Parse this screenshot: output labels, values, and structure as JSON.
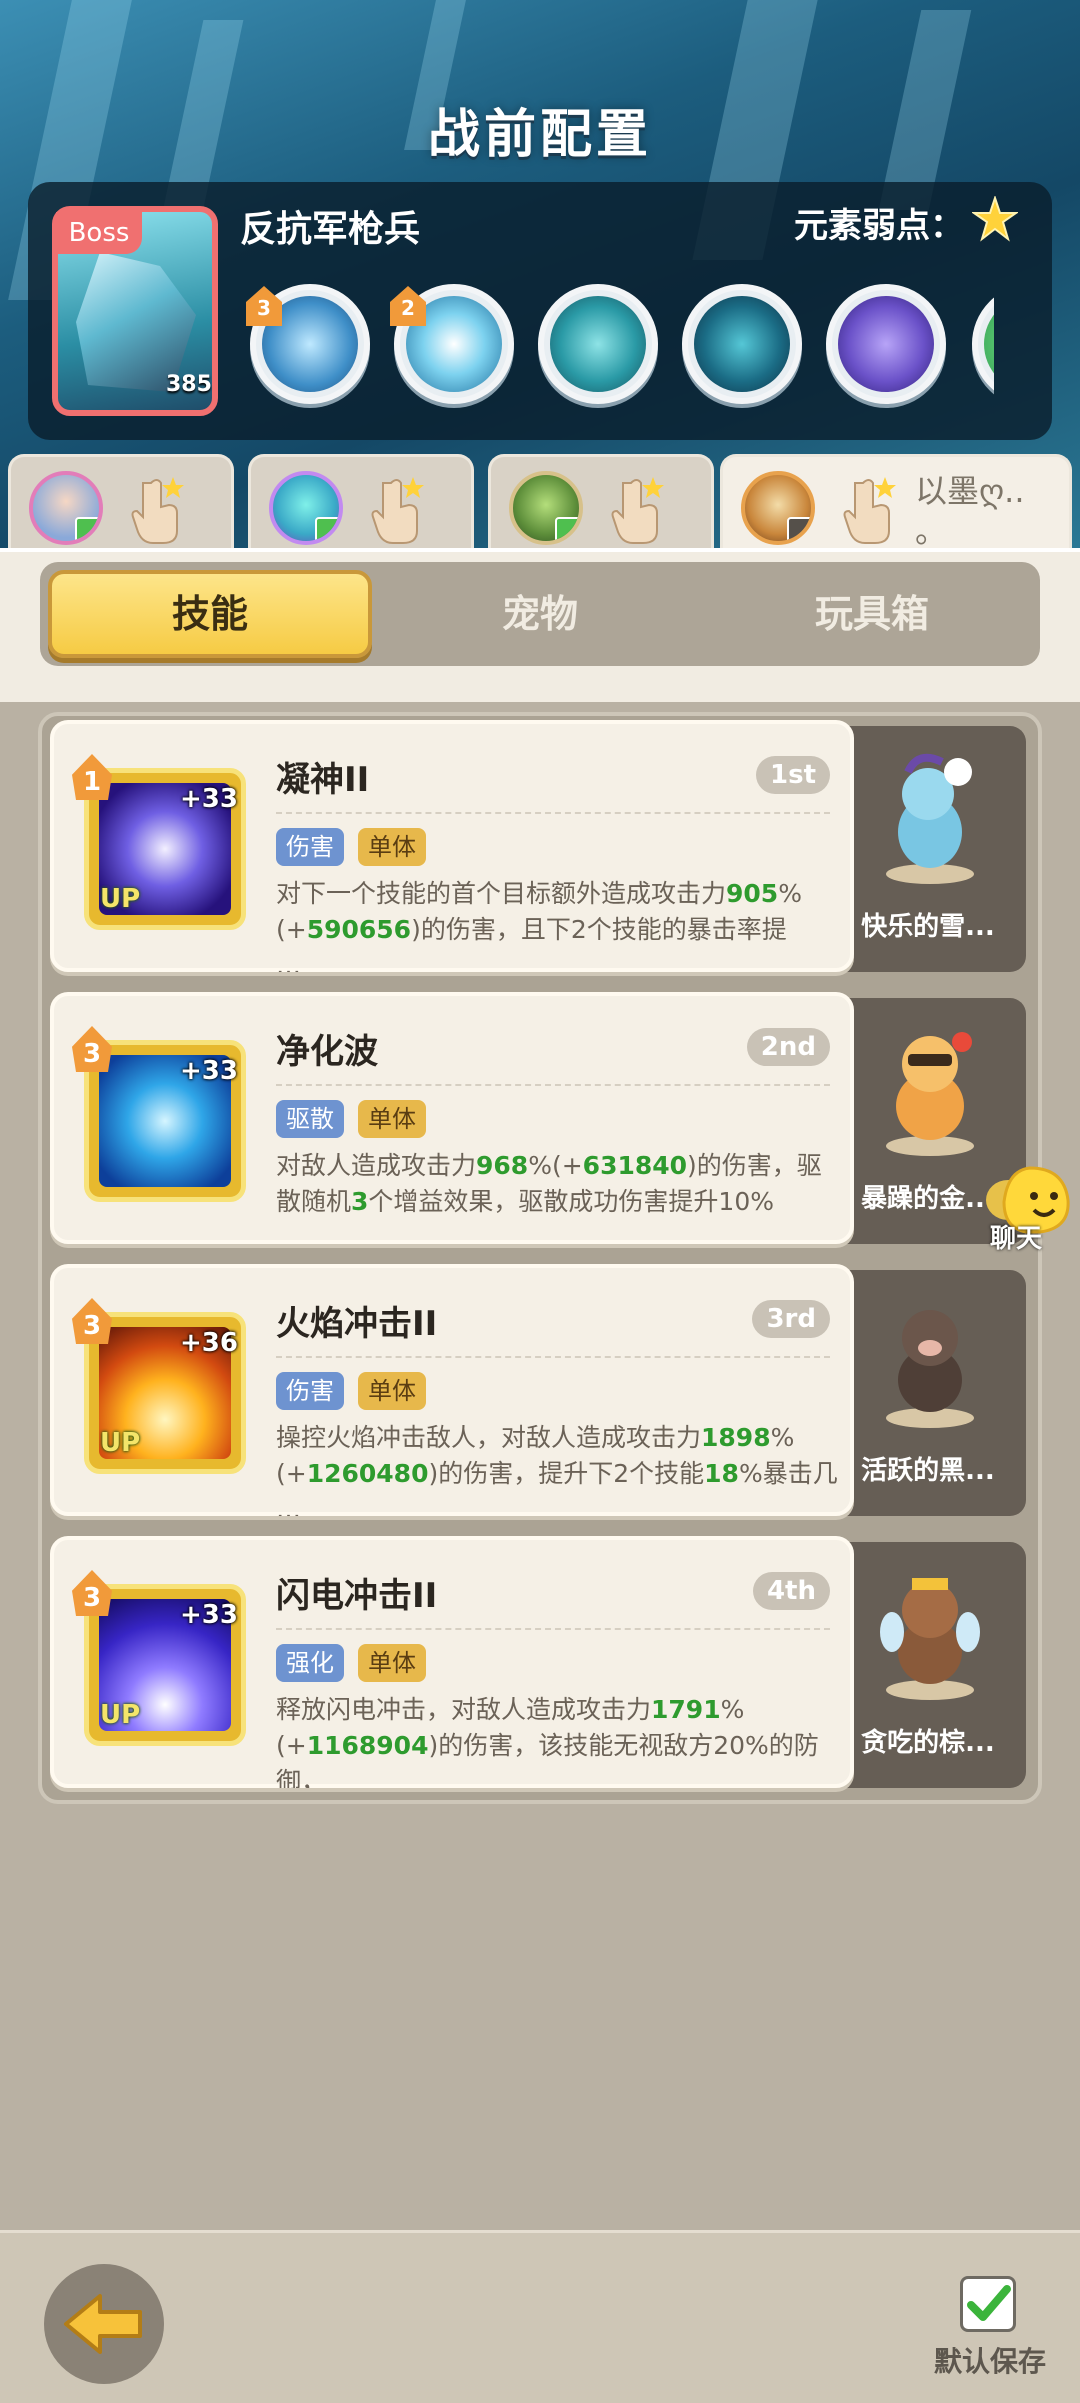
{
  "header": {
    "title": "战前配置"
  },
  "boss": {
    "tag": "Boss",
    "level": "385",
    "name": "反抗军枪兵",
    "weakness_label": "元素弱点：",
    "weakness_icon": "light-star-icon",
    "skills": [
      {
        "icon": "ice-spear-skill-icon",
        "badge": "3"
      },
      {
        "icon": "eye-skill-icon",
        "badge": "2"
      },
      {
        "icon": "totem-skill-icon",
        "badge": ""
      },
      {
        "icon": "shadow-beast-skill-icon",
        "badge": ""
      },
      {
        "icon": "purple-blob-skill-icon",
        "badge": ""
      }
    ]
  },
  "team_slots": [
    {
      "avatar": "girl-avatar",
      "label": ""
    },
    {
      "avatar": "robot-avatar",
      "label": ""
    },
    {
      "avatar": "frog-avatar",
      "label": ""
    },
    {
      "avatar": "knight-avatar",
      "label": "以墨ღ..\n。"
    }
  ],
  "tabs": {
    "skills": "技能",
    "pets": "宠物",
    "toybox": "玩具箱",
    "active": "skills"
  },
  "skills": [
    {
      "name": "凝神II",
      "order": "1st",
      "level": "1",
      "plus": "+33",
      "up": "UP",
      "tags": [
        "伤害",
        "单体"
      ],
      "desc_parts": [
        "对下一个技能的首个目标额外造成攻击力",
        "905",
        "%(+",
        "590656",
        ")的伤害，且下2个技能的暴击率提",
        "…"
      ],
      "pet": "快乐的雪..."
    },
    {
      "name": "净化波",
      "order": "2nd",
      "level": "3",
      "plus": "+33",
      "up": "",
      "tags": [
        "驱散",
        "单体"
      ],
      "desc_parts": [
        "对敌人造成攻击力",
        "968",
        "%(+",
        "631840",
        ")的伤害，驱散随机",
        "3",
        "个增益效果，驱散成功伤害提升10%"
      ],
      "pet": "暴躁的金..."
    },
    {
      "name": "火焰冲击II",
      "order": "3rd",
      "level": "3",
      "plus": "+36",
      "up": "UP",
      "tags": [
        "伤害",
        "单体"
      ],
      "desc_parts": [
        "操控火焰冲击敌人，对敌人造成攻击力",
        "1898",
        "%(+",
        "1260480",
        ")的伤害，提升下2个技能",
        "18",
        "%暴击几",
        "…"
      ],
      "pet": "活跃的黑..."
    },
    {
      "name": "闪电冲击II",
      "order": "4th",
      "level": "3",
      "plus": "+33",
      "up": "UP",
      "tags": [
        "强化",
        "单体"
      ],
      "desc_parts": [
        "释放闪电冲击，对敌人造成攻击力",
        "1791",
        "%(+",
        "1168904",
        ")的伤害，该技能无视敌方20%的防御，",
        "…"
      ],
      "pet": "贪吃的棕..."
    }
  ],
  "chat": {
    "label": "聊天"
  },
  "footer": {
    "save_label": "默认保存",
    "save_checked": true
  },
  "colors": {
    "accent_gold": "#f6cb44",
    "highlight_green": "#2e9b2e",
    "boss_red": "#f07070"
  }
}
